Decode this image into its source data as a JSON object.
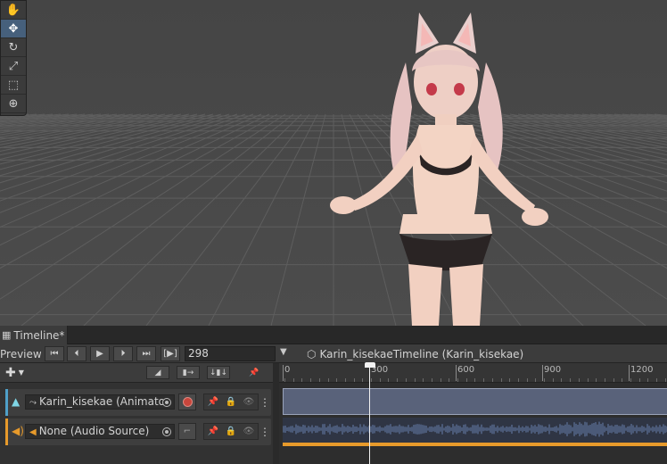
{
  "scene": {
    "tools": [
      {
        "name": "hand-tool",
        "icon": "hand-icon",
        "glyph": "✋",
        "active": false
      },
      {
        "name": "move-tool",
        "icon": "move-icon",
        "glyph": "✥",
        "active": true
      },
      {
        "name": "rotate-tool",
        "icon": "rotate-icon",
        "glyph": "↻",
        "active": false
      },
      {
        "name": "scale-tool",
        "icon": "scale-icon",
        "glyph": "⤢",
        "active": false
      },
      {
        "name": "rect-tool",
        "icon": "rect-icon",
        "glyph": "⬚",
        "active": false
      },
      {
        "name": "transform-tool",
        "icon": "transform-icon",
        "glyph": "⊕",
        "active": false
      }
    ]
  },
  "timeline": {
    "tab_title": "Timeline*",
    "toolbar": {
      "preview_label": "Preview",
      "frame_value": "298",
      "asset_name": "Karin_kisekaeTimeline (Karin_kisekae)"
    },
    "ruler": {
      "labels": [
        "0",
        "300",
        "600",
        "900",
        "1200"
      ]
    },
    "tracks": [
      {
        "name": "animation-track",
        "binding": "Karin_kisekae (Animato",
        "color": "#4fa0c8"
      },
      {
        "name": "audio-track",
        "binding": "None (Audio Source)",
        "color": "#e79a2b"
      }
    ],
    "playhead_frame": 298,
    "colors": {
      "anim_clip": "#59627a",
      "audio_bar": "#e79a2b",
      "record": "#c8463c",
      "active_tool": "#46607c"
    }
  }
}
